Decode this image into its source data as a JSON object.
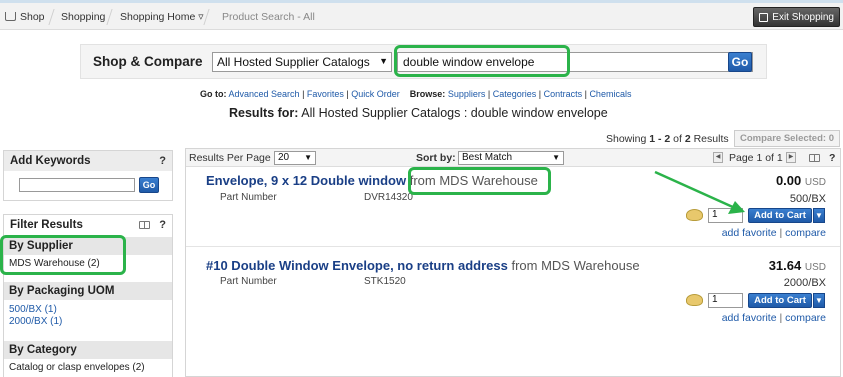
{
  "breadcrumb": {
    "items": [
      "Shop",
      "Shopping",
      "Shopping Home ▿",
      "Product Search - All"
    ],
    "exit_label": "Exit Shopping"
  },
  "search": {
    "label": "Shop & Compare",
    "catalog": "All Hosted Supplier Catalogs",
    "query": "double window envelope",
    "go_label": "Go"
  },
  "links": {
    "goto_label": "Go to:",
    "goto": [
      "Advanced Search",
      "Favorites",
      "Quick Order"
    ],
    "browse_label": "Browse:",
    "browse": [
      "Suppliers",
      "Categories",
      "Contracts",
      "Chemicals"
    ]
  },
  "results_for": {
    "label": "Results for:",
    "value": "All Hosted Supplier Catalogs : double window envelope"
  },
  "showing": {
    "prefix": "Showing",
    "range": "1 - 2",
    "of_label": "of",
    "total": "2",
    "suffix": "Results",
    "compare_label": "Compare Selected: 0"
  },
  "keywords": {
    "title": "Add Keywords",
    "help": "?",
    "go_label": "Go"
  },
  "filters": {
    "title": "Filter Results",
    "help": "?",
    "sections": [
      {
        "title": "By Supplier",
        "items": [
          "MDS Warehouse (2)"
        ]
      },
      {
        "title": "By Packaging UOM",
        "items": [
          "500/BX (1)",
          "2000/BX (1)"
        ]
      },
      {
        "title": "By Category",
        "items": [
          "Catalog or clasp envelopes (2)"
        ]
      }
    ]
  },
  "results_header": {
    "per_page_label": "Results Per Page",
    "per_page": "20",
    "sort_label": "Sort by:",
    "sort_value": "Best Match",
    "page_text": "Page 1 of 1",
    "help": "?"
  },
  "products": [
    {
      "title": "Envelope, 9 x 12 Double window",
      "vendor": "from MDS Warehouse",
      "part_label": "Part Number",
      "part": "DVR14320",
      "price": "0.00",
      "currency": "USD",
      "uom": "500/BX",
      "qty": "1",
      "add_label": "Add to Cart",
      "fav_label": "add favorite",
      "compare_label": "compare"
    },
    {
      "title": "#10 Double Window Envelope, no return address",
      "vendor": "from MDS Warehouse",
      "part_label": "Part Number",
      "part": "STK1520",
      "price": "31.64",
      "currency": "USD",
      "uom": "2000/BX",
      "qty": "1",
      "add_label": "Add to Cart",
      "fav_label": "add favorite",
      "compare_label": "compare"
    }
  ],
  "colors": {
    "highlight": "#2bb34a",
    "link": "#1f5aa8",
    "title": "#1a3f86"
  }
}
